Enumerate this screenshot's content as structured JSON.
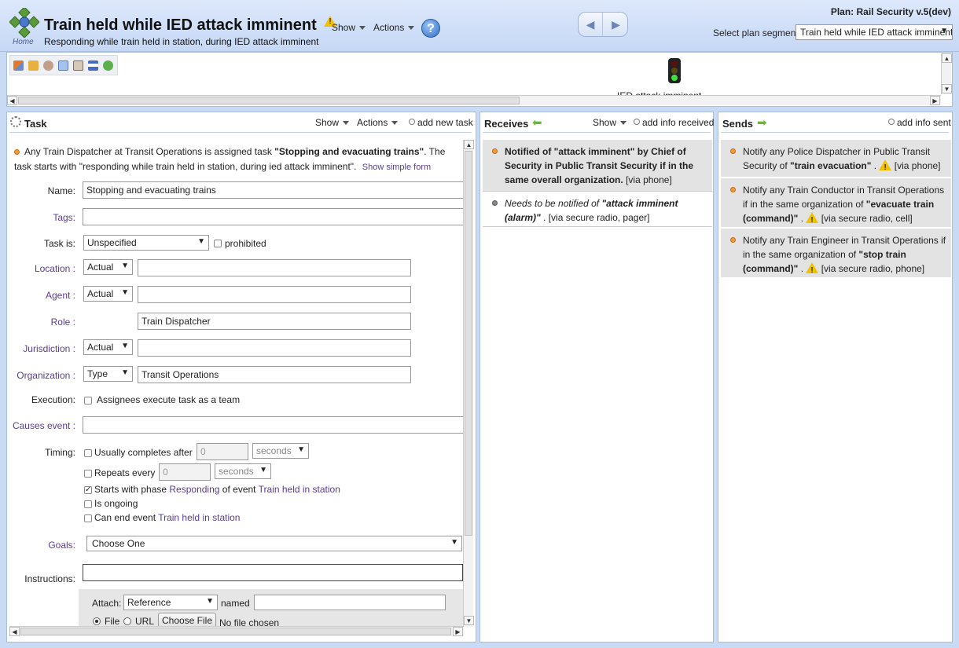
{
  "header": {
    "title": "Train held while IED attack imminent",
    "subtitle": "Responding while train held in station, during IED attack imminent",
    "home_label": "Home",
    "show_menu": "Show",
    "actions_menu": "Actions",
    "help_icon": "?",
    "plan_title": "Plan: Rail Security v.5(dev)",
    "segment_label": "Select plan segment:",
    "segment_value": "Train held while IED attack imminent",
    "nav_back": "◀",
    "nav_forward": "▶"
  },
  "flow_map": {
    "caption": "IED attack imminent",
    "toolbar_icons": [
      "layout-icon",
      "export-icon",
      "settings-icon",
      "zoom-icon",
      "fit-icon",
      "grid-icon",
      "refresh-icon"
    ]
  },
  "task_panel": {
    "title": "Task",
    "show_menu": "Show",
    "actions_menu": "Actions",
    "add_link": "add new task",
    "summary_prefix": "Any Train Dispatcher at Transit Operations is assigned task ",
    "summary_task": "\"Stopping and evacuating trains\"",
    "summary_suffix": ". The task starts with \"responding while train held in station, during ied attack imminent\".",
    "show_simple_form": "Show simple form",
    "fields": {
      "name_label": "Name:",
      "name_value": "Stopping and evacuating trains",
      "tags_label": "Tags:",
      "tags_value": "",
      "task_is_label": "Task is:",
      "task_is_value": "Unspecified",
      "prohibited_label": "prohibited",
      "location_label": "Location :",
      "location_select": "Actual",
      "location_value": "",
      "agent_label": "Agent :",
      "agent_select": "Actual",
      "agent_value": "",
      "role_label": "Role :",
      "role_value": "Train Dispatcher",
      "jurisdiction_label": "Jurisdiction :",
      "jurisdiction_select": "Actual",
      "jurisdiction_value": "",
      "organization_label": "Organization :",
      "organization_select": "Type",
      "organization_value": "Transit Operations",
      "execution_label": "Execution:",
      "execution_text": "Assignees execute task as a team",
      "causes_event_label": "Causes event :",
      "causes_event_value": "",
      "timing_label": "Timing:",
      "usually_completes": "Usually completes after",
      "completes_value": "0",
      "completes_unit": "seconds",
      "repeats_every": "Repeats every",
      "repeats_value": "0",
      "repeats_unit": "seconds",
      "starts_with_phase": "Starts with phase",
      "phase_link": "Responding",
      "of_event": "of event",
      "event_link": "Train held in station",
      "is_ongoing": "Is ongoing",
      "can_end_event": "Can end event",
      "can_end_event_link": "Train held in station",
      "goals_label": "Goals:",
      "goals_value": "Choose One",
      "instructions_label": "Instructions:",
      "attach_label": "Attach:",
      "attach_type": "Reference",
      "named_label": "named",
      "file_label": "File",
      "url_label": "URL",
      "choose_file": "Choose File",
      "no_file": "No file chosen"
    }
  },
  "receives_panel": {
    "title": "Receives",
    "show_menu": "Show",
    "add_link": "add info received",
    "items": [
      {
        "prefix": "Notified of ",
        "info": "\"attack imminent\"",
        "rest": " by Chief of Security in Public Transit Security if in the same overall organization.",
        "via": "[via phone]"
      },
      {
        "prefix": "Needs to be notified of ",
        "info": "\"attack imminent (alarm)\"",
        "rest": " .",
        "via": "[via secure radio, pager]"
      }
    ]
  },
  "sends_panel": {
    "title": "Sends",
    "add_link": "add info sent",
    "items": [
      {
        "text": "Notify any Police Dispatcher in Public Transit Security of ",
        "info": "\"train evacuation\"",
        "via": "[via phone]"
      },
      {
        "text": "Notify any Train Conductor in Transit Operations if in the same organization of ",
        "info": "\"evacuate train (command)\"",
        "via": "[via secure radio, cell]"
      },
      {
        "text": "Notify any Train Engineer in Transit Operations if in the same organization of ",
        "info": "\"stop train (command)\"",
        "via": "[via secure radio, phone]"
      }
    ]
  }
}
